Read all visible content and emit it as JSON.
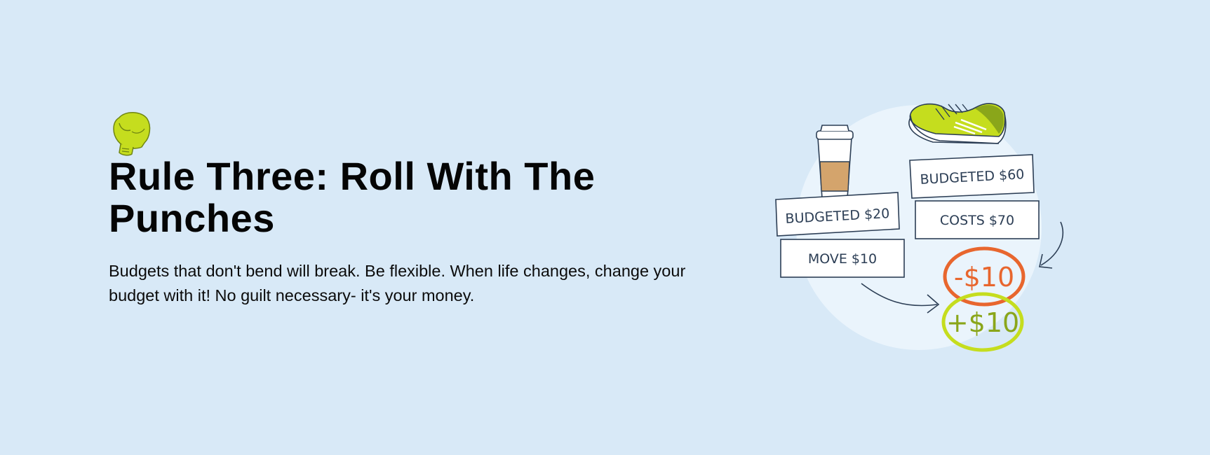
{
  "rule": {
    "title": "Rule Three: Roll With The Punches",
    "description": "Budgets that don't bend will break. Be flexible. When life changes, change your budget with it! No guilt necessary- it's your money."
  },
  "illustration": {
    "labels": {
      "budgeted_20": "BUDGETED $20",
      "move_10": "MOVE $10",
      "budgeted_60": "BUDGETED $60",
      "costs_70": "COSTS $70",
      "minus_10": "-$10",
      "plus_10": "+$10"
    },
    "icons": [
      "boxing-glove-icon",
      "coffee-cup-icon",
      "sneaker-icon",
      "arrow-icon"
    ],
    "colors": {
      "background": "#d8e9f7",
      "circle": "#eaf4fc",
      "ink": "#2c3e55",
      "lime": "#c5dd1e",
      "orange": "#e8662e",
      "cup_sleeve": "#d4a46c"
    }
  }
}
